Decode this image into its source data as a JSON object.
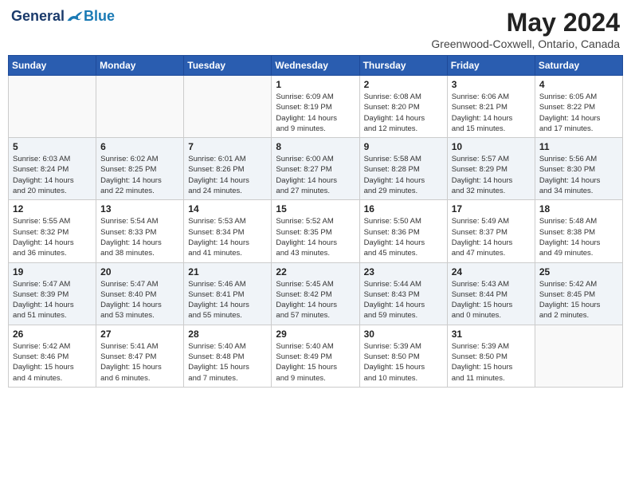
{
  "header": {
    "logo_general": "General",
    "logo_blue": "Blue",
    "month_title": "May 2024",
    "subtitle": "Greenwood-Coxwell, Ontario, Canada"
  },
  "days_of_week": [
    "Sunday",
    "Monday",
    "Tuesday",
    "Wednesday",
    "Thursday",
    "Friday",
    "Saturday"
  ],
  "weeks": [
    [
      {
        "day": "",
        "info": ""
      },
      {
        "day": "",
        "info": ""
      },
      {
        "day": "",
        "info": ""
      },
      {
        "day": "1",
        "info": "Sunrise: 6:09 AM\nSunset: 8:19 PM\nDaylight: 14 hours\nand 9 minutes."
      },
      {
        "day": "2",
        "info": "Sunrise: 6:08 AM\nSunset: 8:20 PM\nDaylight: 14 hours\nand 12 minutes."
      },
      {
        "day": "3",
        "info": "Sunrise: 6:06 AM\nSunset: 8:21 PM\nDaylight: 14 hours\nand 15 minutes."
      },
      {
        "day": "4",
        "info": "Sunrise: 6:05 AM\nSunset: 8:22 PM\nDaylight: 14 hours\nand 17 minutes."
      }
    ],
    [
      {
        "day": "5",
        "info": "Sunrise: 6:03 AM\nSunset: 8:24 PM\nDaylight: 14 hours\nand 20 minutes."
      },
      {
        "day": "6",
        "info": "Sunrise: 6:02 AM\nSunset: 8:25 PM\nDaylight: 14 hours\nand 22 minutes."
      },
      {
        "day": "7",
        "info": "Sunrise: 6:01 AM\nSunset: 8:26 PM\nDaylight: 14 hours\nand 24 minutes."
      },
      {
        "day": "8",
        "info": "Sunrise: 6:00 AM\nSunset: 8:27 PM\nDaylight: 14 hours\nand 27 minutes."
      },
      {
        "day": "9",
        "info": "Sunrise: 5:58 AM\nSunset: 8:28 PM\nDaylight: 14 hours\nand 29 minutes."
      },
      {
        "day": "10",
        "info": "Sunrise: 5:57 AM\nSunset: 8:29 PM\nDaylight: 14 hours\nand 32 minutes."
      },
      {
        "day": "11",
        "info": "Sunrise: 5:56 AM\nSunset: 8:30 PM\nDaylight: 14 hours\nand 34 minutes."
      }
    ],
    [
      {
        "day": "12",
        "info": "Sunrise: 5:55 AM\nSunset: 8:32 PM\nDaylight: 14 hours\nand 36 minutes."
      },
      {
        "day": "13",
        "info": "Sunrise: 5:54 AM\nSunset: 8:33 PM\nDaylight: 14 hours\nand 38 minutes."
      },
      {
        "day": "14",
        "info": "Sunrise: 5:53 AM\nSunset: 8:34 PM\nDaylight: 14 hours\nand 41 minutes."
      },
      {
        "day": "15",
        "info": "Sunrise: 5:52 AM\nSunset: 8:35 PM\nDaylight: 14 hours\nand 43 minutes."
      },
      {
        "day": "16",
        "info": "Sunrise: 5:50 AM\nSunset: 8:36 PM\nDaylight: 14 hours\nand 45 minutes."
      },
      {
        "day": "17",
        "info": "Sunrise: 5:49 AM\nSunset: 8:37 PM\nDaylight: 14 hours\nand 47 minutes."
      },
      {
        "day": "18",
        "info": "Sunrise: 5:48 AM\nSunset: 8:38 PM\nDaylight: 14 hours\nand 49 minutes."
      }
    ],
    [
      {
        "day": "19",
        "info": "Sunrise: 5:47 AM\nSunset: 8:39 PM\nDaylight: 14 hours\nand 51 minutes."
      },
      {
        "day": "20",
        "info": "Sunrise: 5:47 AM\nSunset: 8:40 PM\nDaylight: 14 hours\nand 53 minutes."
      },
      {
        "day": "21",
        "info": "Sunrise: 5:46 AM\nSunset: 8:41 PM\nDaylight: 14 hours\nand 55 minutes."
      },
      {
        "day": "22",
        "info": "Sunrise: 5:45 AM\nSunset: 8:42 PM\nDaylight: 14 hours\nand 57 minutes."
      },
      {
        "day": "23",
        "info": "Sunrise: 5:44 AM\nSunset: 8:43 PM\nDaylight: 14 hours\nand 59 minutes."
      },
      {
        "day": "24",
        "info": "Sunrise: 5:43 AM\nSunset: 8:44 PM\nDaylight: 15 hours\nand 0 minutes."
      },
      {
        "day": "25",
        "info": "Sunrise: 5:42 AM\nSunset: 8:45 PM\nDaylight: 15 hours\nand 2 minutes."
      }
    ],
    [
      {
        "day": "26",
        "info": "Sunrise: 5:42 AM\nSunset: 8:46 PM\nDaylight: 15 hours\nand 4 minutes."
      },
      {
        "day": "27",
        "info": "Sunrise: 5:41 AM\nSunset: 8:47 PM\nDaylight: 15 hours\nand 6 minutes."
      },
      {
        "day": "28",
        "info": "Sunrise: 5:40 AM\nSunset: 8:48 PM\nDaylight: 15 hours\nand 7 minutes."
      },
      {
        "day": "29",
        "info": "Sunrise: 5:40 AM\nSunset: 8:49 PM\nDaylight: 15 hours\nand 9 minutes."
      },
      {
        "day": "30",
        "info": "Sunrise: 5:39 AM\nSunset: 8:50 PM\nDaylight: 15 hours\nand 10 minutes."
      },
      {
        "day": "31",
        "info": "Sunrise: 5:39 AM\nSunset: 8:50 PM\nDaylight: 15 hours\nand 11 minutes."
      },
      {
        "day": "",
        "info": ""
      }
    ]
  ]
}
